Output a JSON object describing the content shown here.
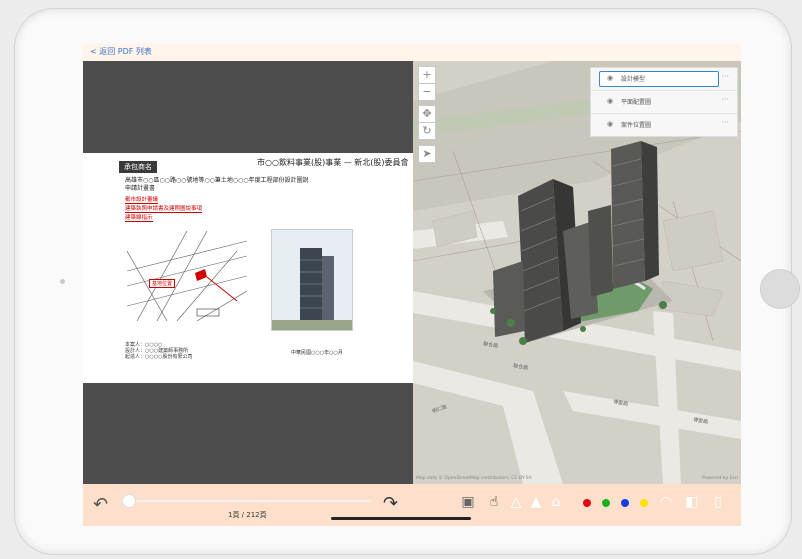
{
  "header": {
    "back_label": "< 返回 PDF 列表"
  },
  "pdf": {
    "title": "市○○飲料事業(股)事業 — 新北(股)委員會",
    "tag": "承包商名",
    "line1": "高雄市○○區○○路○○號地等○○筆土地○○○年度工程部份設計圖說",
    "line2": "申請計畫書",
    "red_items": [
      "都市設計審議",
      "建築執照申請書及建照圖說事項",
      "建築線指示"
    ],
    "map_label": "基地位置",
    "info": [
      "本案人：○○○○",
      "設計人：○○○建築師事務所",
      "起造人：○○○○股份有限公司"
    ],
    "date": "中華民國○○○年○○月"
  },
  "map": {
    "layers": [
      {
        "label": "設計模型"
      },
      {
        "label": "平面配置圖"
      },
      {
        "label": "案件位置圖"
      }
    ],
    "attribution": "Map data © OpenStreetMap contributors, CC-BY-SA",
    "powered": "Powered by Esri"
  },
  "toolbar": {
    "page_indicator": "1頁 / 212頁",
    "page_progress": 0.005
  },
  "colors": {
    "red": "#e60012",
    "green": "#1ab21a",
    "blue": "#1a3cdc",
    "yellow": "#ffe000"
  }
}
